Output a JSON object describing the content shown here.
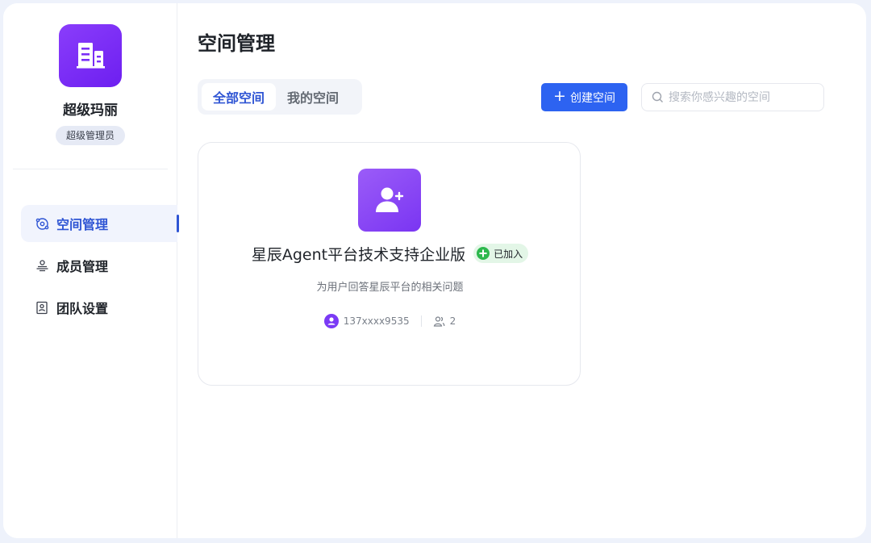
{
  "sidebar": {
    "org_name": "超级玛丽",
    "role": "超级管理员",
    "nav": [
      {
        "label": "空间管理",
        "icon": "space-icon",
        "active": true
      },
      {
        "label": "成员管理",
        "icon": "members-icon",
        "active": false
      },
      {
        "label": "团队设置",
        "icon": "team-settings-icon",
        "active": false
      }
    ]
  },
  "main": {
    "title": "空间管理",
    "tabs": [
      {
        "label": "全部空间",
        "active": true
      },
      {
        "label": "我的空间",
        "active": false
      }
    ],
    "create_button": "创建空间",
    "search": {
      "placeholder": "搜索你感兴趣的空间",
      "value": ""
    }
  },
  "cards": [
    {
      "title": "星辰Agent平台技术支持企业版",
      "badge": "已加入",
      "description": "为用户回答星辰平台的相关问题",
      "owner": "137xxxx9535",
      "member_count": "2",
      "avatar_icon": "user-add-icon"
    }
  ],
  "colors": {
    "accent": "#2d63f1",
    "nav_active": "#2f55d4",
    "logo_purple": "#7b2ff7",
    "card_avatar_purple": "#8a47f5",
    "joined_green": "#2db84d",
    "joined_bg": "#e3f6e7"
  }
}
